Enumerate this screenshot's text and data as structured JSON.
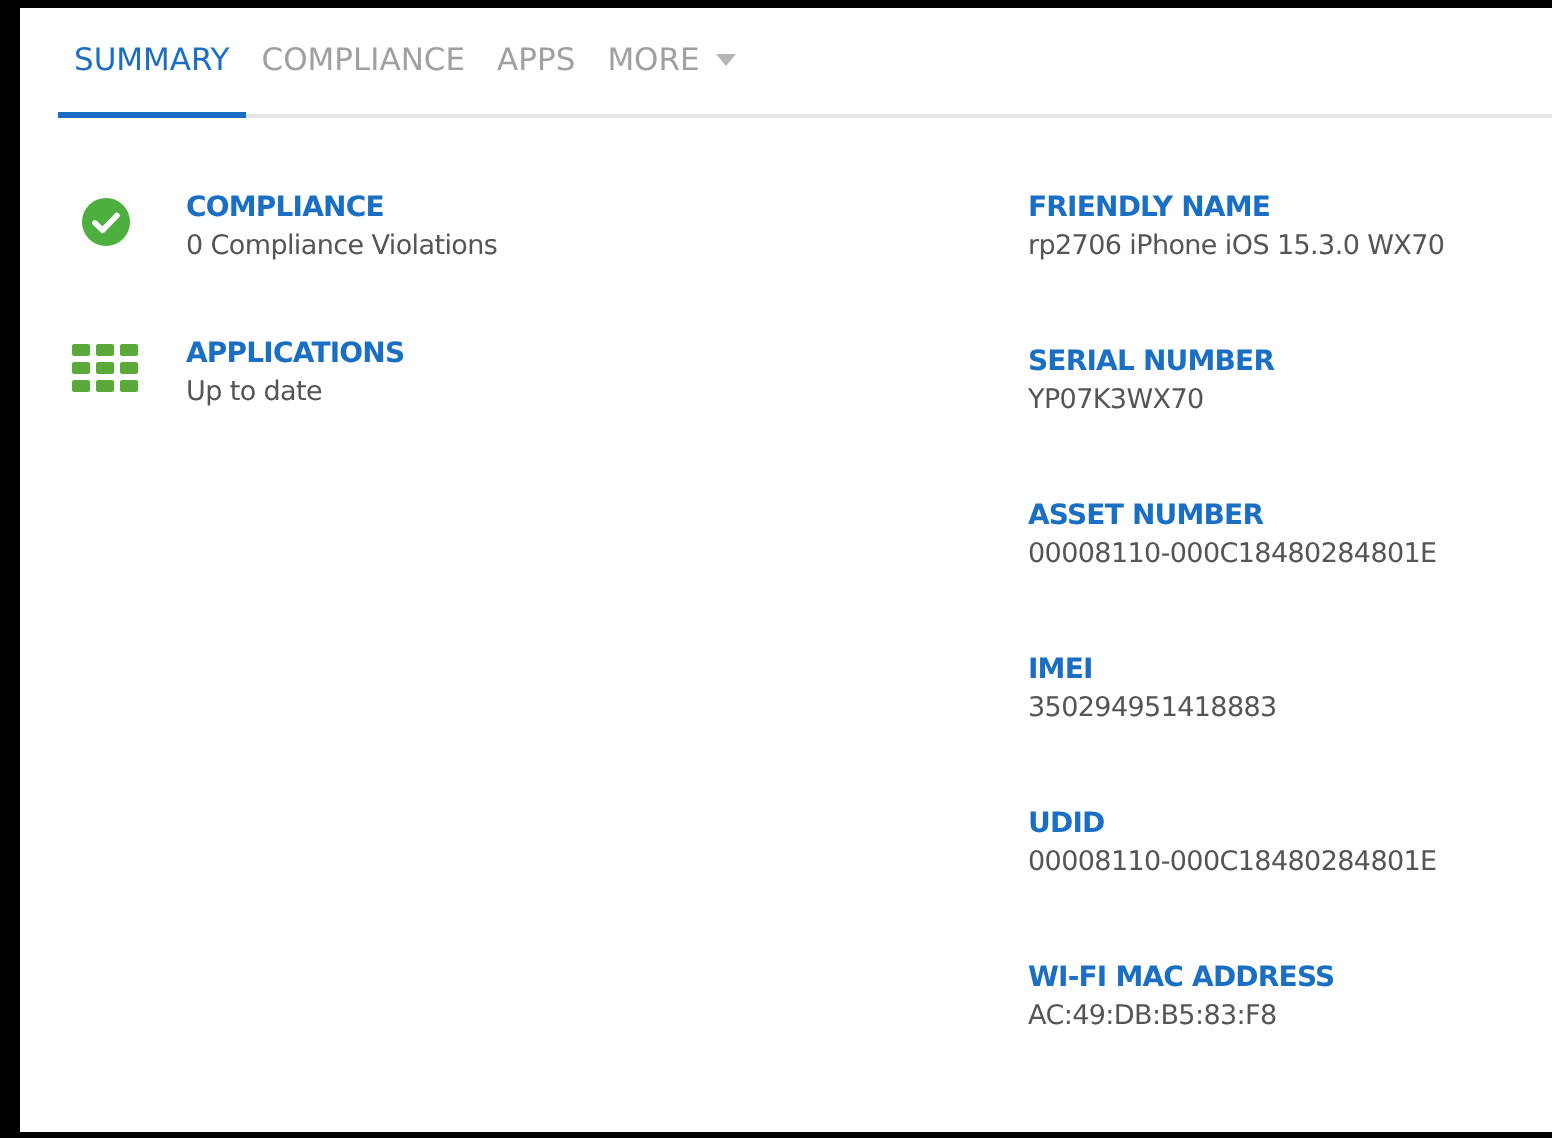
{
  "tabs": [
    {
      "label": "SUMMARY",
      "selected": true,
      "dropdown": false
    },
    {
      "label": "COMPLIANCE",
      "selected": false,
      "dropdown": false
    },
    {
      "label": "APPS",
      "selected": false,
      "dropdown": false
    },
    {
      "label": "MORE",
      "selected": false,
      "dropdown": true
    }
  ],
  "status_items": [
    {
      "kind": "check",
      "title": "COMPLIANCE",
      "value": "0 Compliance Violations"
    },
    {
      "kind": "grid",
      "title": "APPLICATIONS",
      "value": "Up to date"
    }
  ],
  "details": [
    {
      "label": "FRIENDLY NAME",
      "value": "rp2706 iPhone iOS 15.3.0 WX70"
    },
    {
      "label": "SERIAL NUMBER",
      "value": "YP07K3WX70"
    },
    {
      "label": "ASSET NUMBER",
      "value": "00008110-000C18480284801E"
    },
    {
      "label": "IMEI",
      "value": "350294951418883"
    },
    {
      "label": "UDID",
      "value": "00008110-000C18480284801E"
    },
    {
      "label": "WI-FI MAC ADDRESS",
      "value": "AC:49:DB:B5:83:F8"
    }
  ]
}
